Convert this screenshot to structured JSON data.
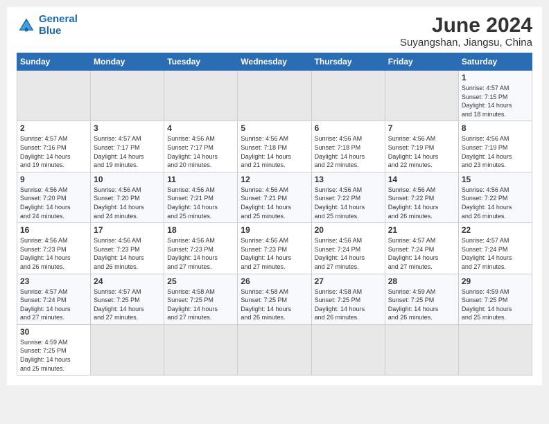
{
  "header": {
    "logo_general": "General",
    "logo_blue": "Blue",
    "calendar_title": "June 2024",
    "calendar_subtitle": "Suyangshan, Jiangsu, China"
  },
  "days_of_week": [
    "Sunday",
    "Monday",
    "Tuesday",
    "Wednesday",
    "Thursday",
    "Friday",
    "Saturday"
  ],
  "weeks": [
    [
      {
        "day": "",
        "info": ""
      },
      {
        "day": "",
        "info": ""
      },
      {
        "day": "",
        "info": ""
      },
      {
        "day": "",
        "info": ""
      },
      {
        "day": "",
        "info": ""
      },
      {
        "day": "",
        "info": ""
      },
      {
        "day": "1",
        "info": "Sunrise: 4:57 AM\nSunset: 7:15 PM\nDaylight: 14 hours\nand 18 minutes."
      }
    ],
    [
      {
        "day": "2",
        "info": "Sunrise: 4:57 AM\nSunset: 7:16 PM\nDaylight: 14 hours\nand 19 minutes."
      },
      {
        "day": "3",
        "info": "Sunrise: 4:57 AM\nSunset: 7:17 PM\nDaylight: 14 hours\nand 19 minutes."
      },
      {
        "day": "4",
        "info": "Sunrise: 4:56 AM\nSunset: 7:17 PM\nDaylight: 14 hours\nand 20 minutes."
      },
      {
        "day": "5",
        "info": "Sunrise: 4:56 AM\nSunset: 7:18 PM\nDaylight: 14 hours\nand 21 minutes."
      },
      {
        "day": "6",
        "info": "Sunrise: 4:56 AM\nSunset: 7:18 PM\nDaylight: 14 hours\nand 22 minutes."
      },
      {
        "day": "7",
        "info": "Sunrise: 4:56 AM\nSunset: 7:19 PM\nDaylight: 14 hours\nand 22 minutes."
      },
      {
        "day": "8",
        "info": "Sunrise: 4:56 AM\nSunset: 7:19 PM\nDaylight: 14 hours\nand 23 minutes."
      }
    ],
    [
      {
        "day": "9",
        "info": "Sunrise: 4:56 AM\nSunset: 7:20 PM\nDaylight: 14 hours\nand 24 minutes."
      },
      {
        "day": "10",
        "info": "Sunrise: 4:56 AM\nSunset: 7:20 PM\nDaylight: 14 hours\nand 24 minutes."
      },
      {
        "day": "11",
        "info": "Sunrise: 4:56 AM\nSunset: 7:21 PM\nDaylight: 14 hours\nand 25 minutes."
      },
      {
        "day": "12",
        "info": "Sunrise: 4:56 AM\nSunset: 7:21 PM\nDaylight: 14 hours\nand 25 minutes."
      },
      {
        "day": "13",
        "info": "Sunrise: 4:56 AM\nSunset: 7:22 PM\nDaylight: 14 hours\nand 25 minutes."
      },
      {
        "day": "14",
        "info": "Sunrise: 4:56 AM\nSunset: 7:22 PM\nDaylight: 14 hours\nand 26 minutes."
      },
      {
        "day": "15",
        "info": "Sunrise: 4:56 AM\nSunset: 7:22 PM\nDaylight: 14 hours\nand 26 minutes."
      }
    ],
    [
      {
        "day": "16",
        "info": "Sunrise: 4:56 AM\nSunset: 7:23 PM\nDaylight: 14 hours\nand 26 minutes."
      },
      {
        "day": "17",
        "info": "Sunrise: 4:56 AM\nSunset: 7:23 PM\nDaylight: 14 hours\nand 26 minutes."
      },
      {
        "day": "18",
        "info": "Sunrise: 4:56 AM\nSunset: 7:23 PM\nDaylight: 14 hours\nand 27 minutes."
      },
      {
        "day": "19",
        "info": "Sunrise: 4:56 AM\nSunset: 7:23 PM\nDaylight: 14 hours\nand 27 minutes."
      },
      {
        "day": "20",
        "info": "Sunrise: 4:56 AM\nSunset: 7:24 PM\nDaylight: 14 hours\nand 27 minutes."
      },
      {
        "day": "21",
        "info": "Sunrise: 4:57 AM\nSunset: 7:24 PM\nDaylight: 14 hours\nand 27 minutes."
      },
      {
        "day": "22",
        "info": "Sunrise: 4:57 AM\nSunset: 7:24 PM\nDaylight: 14 hours\nand 27 minutes."
      }
    ],
    [
      {
        "day": "23",
        "info": "Sunrise: 4:57 AM\nSunset: 7:24 PM\nDaylight: 14 hours\nand 27 minutes."
      },
      {
        "day": "24",
        "info": "Sunrise: 4:57 AM\nSunset: 7:25 PM\nDaylight: 14 hours\nand 27 minutes."
      },
      {
        "day": "25",
        "info": "Sunrise: 4:58 AM\nSunset: 7:25 PM\nDaylight: 14 hours\nand 27 minutes."
      },
      {
        "day": "26",
        "info": "Sunrise: 4:58 AM\nSunset: 7:25 PM\nDaylight: 14 hours\nand 26 minutes."
      },
      {
        "day": "27",
        "info": "Sunrise: 4:58 AM\nSunset: 7:25 PM\nDaylight: 14 hours\nand 26 minutes."
      },
      {
        "day": "28",
        "info": "Sunrise: 4:59 AM\nSunset: 7:25 PM\nDaylight: 14 hours\nand 26 minutes."
      },
      {
        "day": "29",
        "info": "Sunrise: 4:59 AM\nSunset: 7:25 PM\nDaylight: 14 hours\nand 25 minutes."
      }
    ],
    [
      {
        "day": "30",
        "info": "Sunrise: 4:59 AM\nSunset: 7:25 PM\nDaylight: 14 hours\nand 25 minutes."
      },
      {
        "day": "",
        "info": ""
      },
      {
        "day": "",
        "info": ""
      },
      {
        "day": "",
        "info": ""
      },
      {
        "day": "",
        "info": ""
      },
      {
        "day": "",
        "info": ""
      },
      {
        "day": "",
        "info": ""
      }
    ]
  ]
}
